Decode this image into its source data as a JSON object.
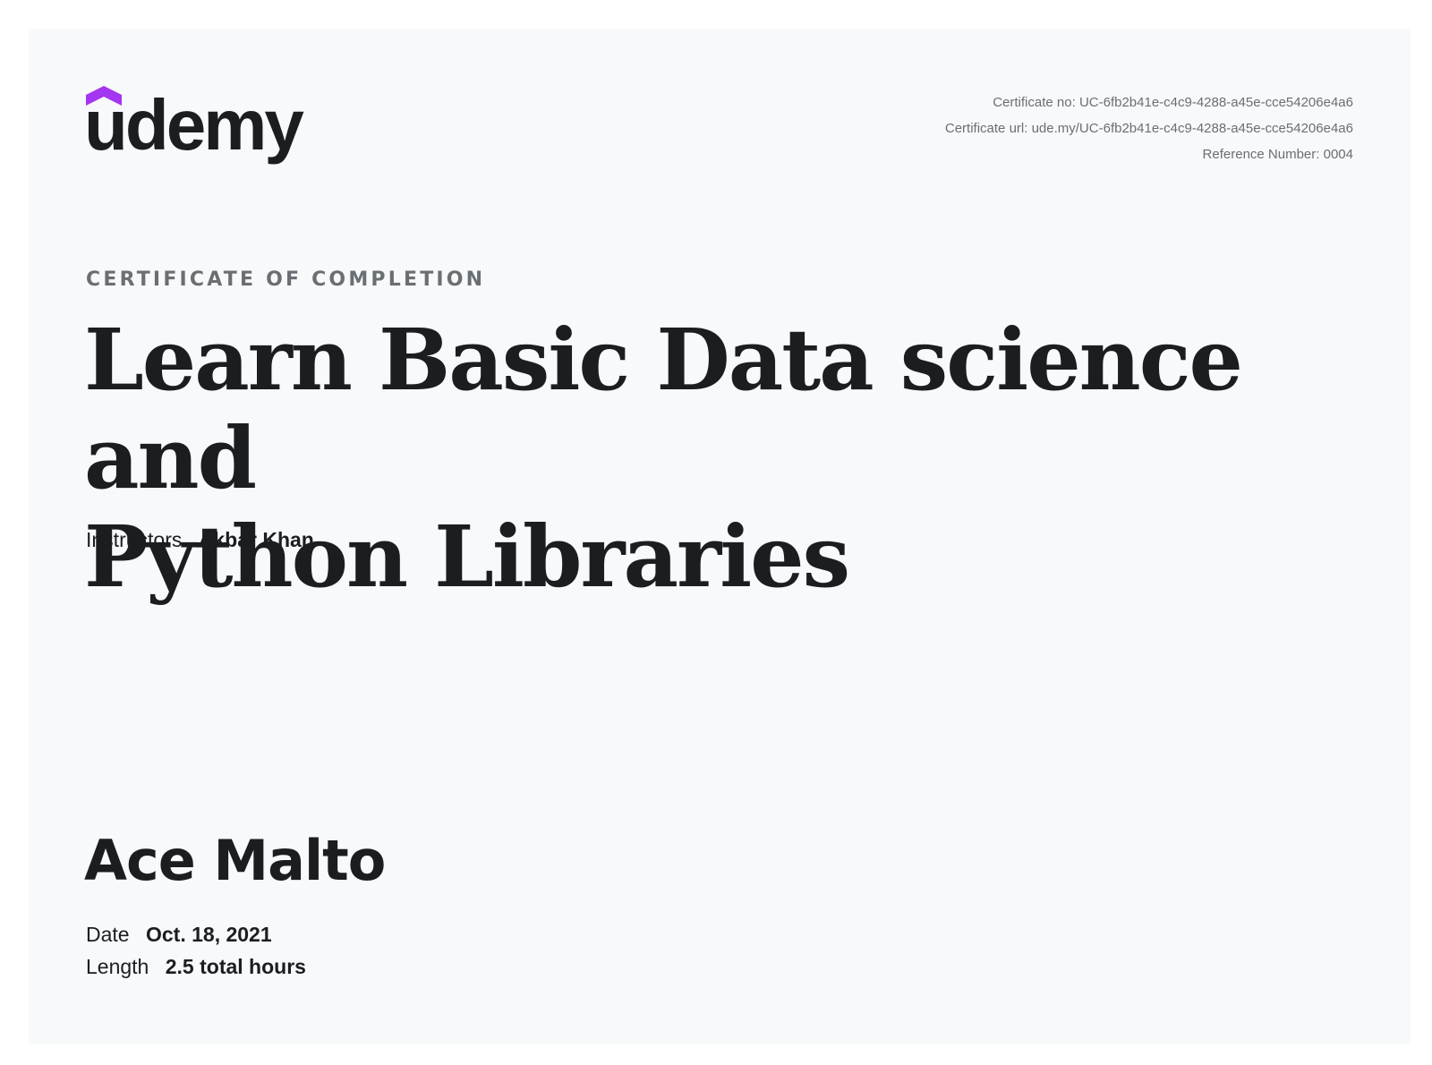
{
  "brand": {
    "name": "udemy",
    "accent_color": "#a435f0",
    "icon": "graduation-cap-icon"
  },
  "meta": {
    "certificate_no_label": "Certificate no:",
    "certificate_no": "UC-6fb2b41e-c4c9-4288-a45e-cce54206e4a6",
    "certificate_url_label": "Certificate url:",
    "certificate_url": "ude.my/UC-6fb2b41e-c4c9-4288-a45e-cce54206e4a6",
    "reference_label": "Reference Number:",
    "reference_number": "0004"
  },
  "heading": "CERTIFICATE OF COMPLETION",
  "course": {
    "title_line1": "Learn Basic Data science and",
    "title_line2": "Python Libraries"
  },
  "instructors": {
    "label": "Instructors",
    "value": "Akbar Khan"
  },
  "student": {
    "name": "Ace Malto"
  },
  "details": {
    "date_label": "Date",
    "date_value": "Oct. 18, 2021",
    "length_label": "Length",
    "length_value": "2.5 total hours"
  },
  "colors": {
    "background": "#f7f9fa",
    "text": "#1c1d1f",
    "muted": "#6a6f73"
  }
}
